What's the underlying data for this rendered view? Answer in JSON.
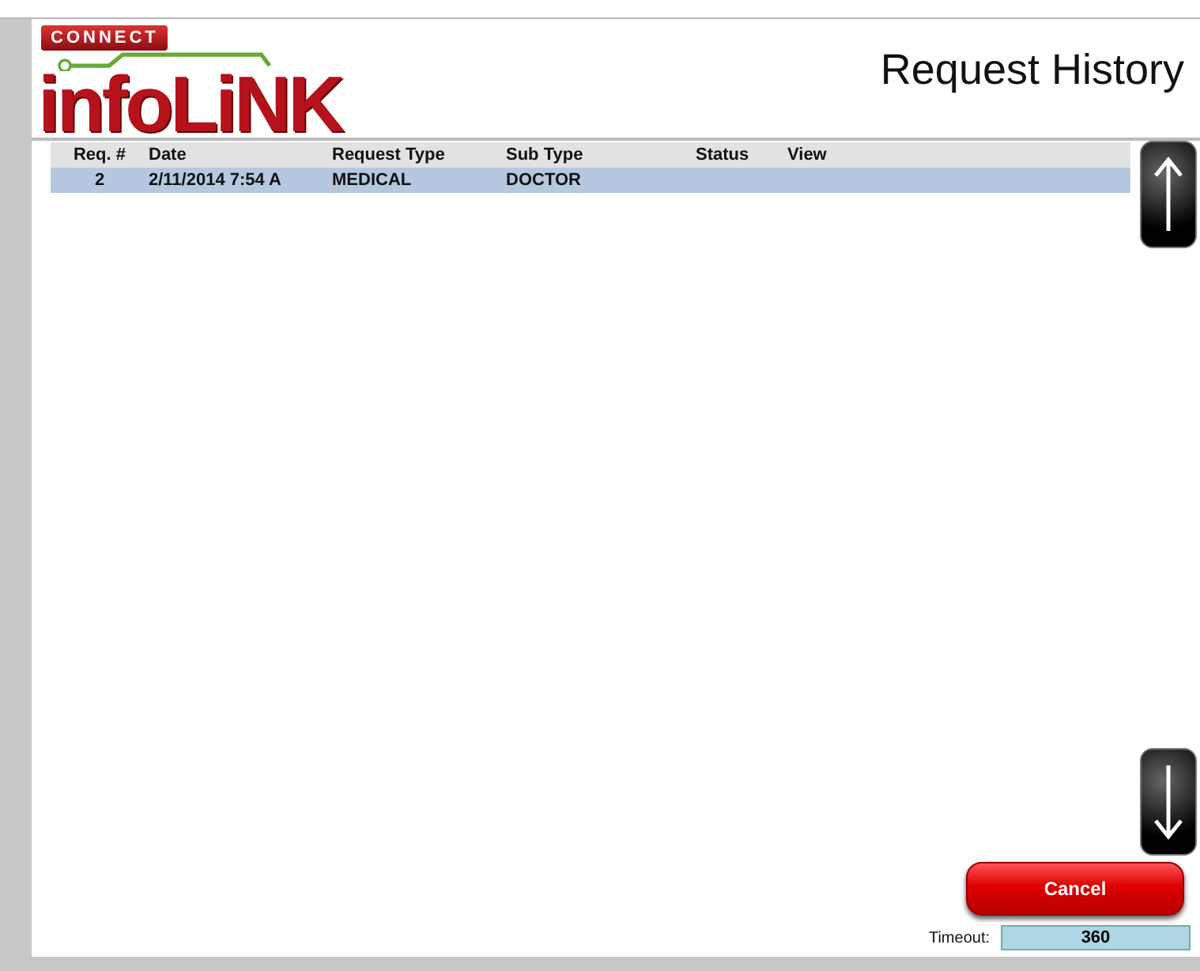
{
  "logo": {
    "tag": "CONNECT",
    "name": "infoLiNK"
  },
  "title": "Request History",
  "table": {
    "columns": [
      "Req. #",
      "Date",
      "Request Type",
      "Sub Type",
      "Status",
      "View"
    ],
    "rows": [
      {
        "selected": true,
        "cells": [
          "2",
          "2/11/2014 7:54 A",
          "MEDICAL",
          "DOCTOR",
          "",
          ""
        ]
      }
    ]
  },
  "cancel_button": "Cancel",
  "timeout": {
    "label": "Timeout:",
    "value": "360"
  }
}
